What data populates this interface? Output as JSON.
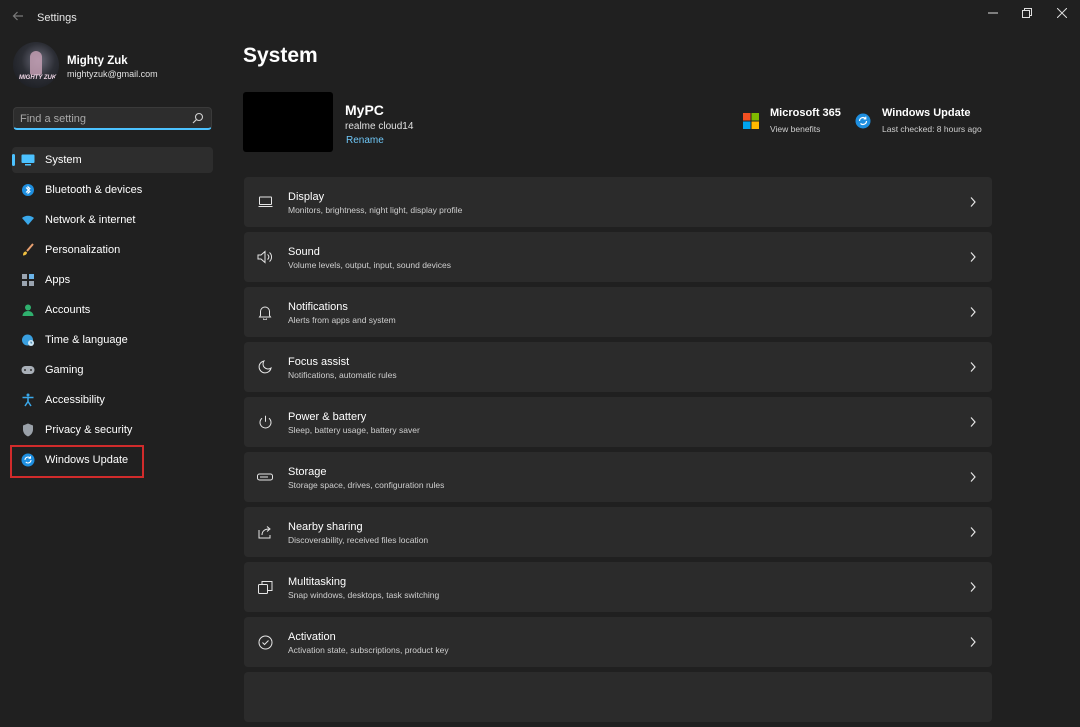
{
  "window": {
    "title": "Settings"
  },
  "profile": {
    "name": "Mighty Zuk",
    "email": "mightyzuk@gmail.com",
    "avatar_text": "MIGHTY ZUK"
  },
  "search": {
    "placeholder": "Find a setting"
  },
  "sidebar": {
    "items": [
      {
        "label": "System",
        "icon": "monitor-icon"
      },
      {
        "label": "Bluetooth & devices",
        "icon": "bluetooth-icon"
      },
      {
        "label": "Network & internet",
        "icon": "wifi-icon"
      },
      {
        "label": "Personalization",
        "icon": "brush-icon"
      },
      {
        "label": "Apps",
        "icon": "apps-icon"
      },
      {
        "label": "Accounts",
        "icon": "person-icon"
      },
      {
        "label": "Time & language",
        "icon": "globe-clock-icon"
      },
      {
        "label": "Gaming",
        "icon": "gamepad-icon"
      },
      {
        "label": "Accessibility",
        "icon": "accessibility-icon"
      },
      {
        "label": "Privacy & security",
        "icon": "shield-icon"
      },
      {
        "label": "Windows Update",
        "icon": "update-icon"
      }
    ],
    "active_index": 0,
    "highlighted_item": "Windows Update"
  },
  "main": {
    "title": "System",
    "device": {
      "name": "MyPC",
      "model": "realme cloud14",
      "rename_label": "Rename"
    },
    "quick": [
      {
        "title": "Microsoft 365",
        "subtitle": "View benefits",
        "icon": "microsoft-logo-icon"
      },
      {
        "title": "Windows Update",
        "subtitle": "Last checked: 8 hours ago",
        "icon": "update-icon"
      }
    ],
    "cards": [
      {
        "title": "Display",
        "subtitle": "Monitors, brightness, night light, display profile",
        "icon": "display-icon"
      },
      {
        "title": "Sound",
        "subtitle": "Volume levels, output, input, sound devices",
        "icon": "speaker-icon"
      },
      {
        "title": "Notifications",
        "subtitle": "Alerts from apps and system",
        "icon": "bell-icon"
      },
      {
        "title": "Focus assist",
        "subtitle": "Notifications, automatic rules",
        "icon": "moon-icon"
      },
      {
        "title": "Power & battery",
        "subtitle": "Sleep, battery usage, battery saver",
        "icon": "power-icon"
      },
      {
        "title": "Storage",
        "subtitle": "Storage space, drives, configuration rules",
        "icon": "storage-icon"
      },
      {
        "title": "Nearby sharing",
        "subtitle": "Discoverability, received files location",
        "icon": "share-icon"
      },
      {
        "title": "Multitasking",
        "subtitle": "Snap windows, desktops, task switching",
        "icon": "multitask-icon"
      },
      {
        "title": "Activation",
        "subtitle": "Activation state, subscriptions, product key",
        "icon": "check-circle-icon"
      }
    ]
  },
  "colors": {
    "background": "#202020",
    "card": "#2b2b2b",
    "accent": "#4cc2ff",
    "link": "#6fc7f7",
    "highlight_border": "#d12b2b"
  }
}
